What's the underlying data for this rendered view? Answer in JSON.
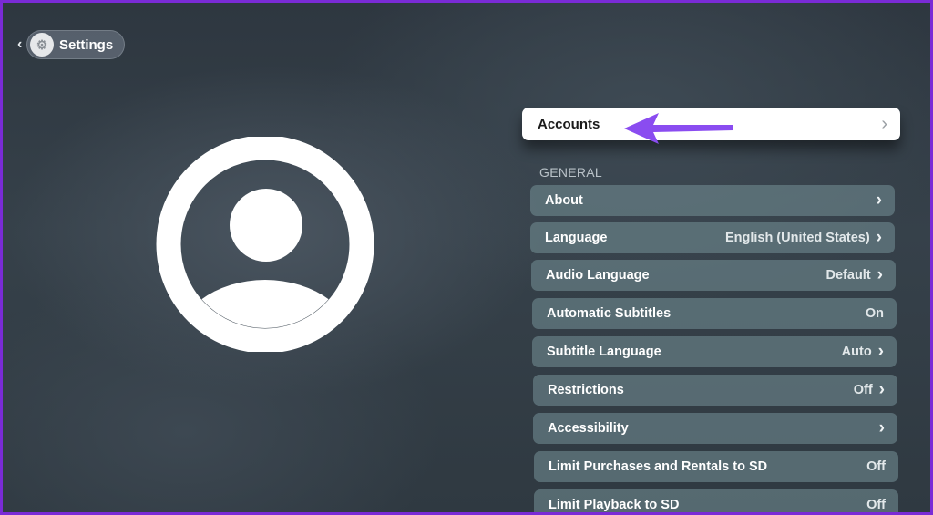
{
  "header": {
    "back_icon": "chevron-left-icon",
    "app_icon": "settings-gear-icon",
    "title": "Settings"
  },
  "profile": {
    "icon": "person-circle-icon"
  },
  "accounts": {
    "label": "Accounts",
    "chevron": "›",
    "annotation": "purple-arrow-pointing-left",
    "annotation_color": "#8a4cf0"
  },
  "general": {
    "header": "GENERAL",
    "items": [
      {
        "label": "About",
        "value": "",
        "chevron": "›"
      },
      {
        "label": "Language",
        "value": "English (United States)",
        "chevron": "›"
      },
      {
        "label": "Audio Language",
        "value": "Default",
        "chevron": "›"
      },
      {
        "label": "Automatic Subtitles",
        "value": "On",
        "chevron": ""
      },
      {
        "label": "Subtitle Language",
        "value": "Auto",
        "chevron": "›"
      },
      {
        "label": "Restrictions",
        "value": "Off",
        "chevron": "›"
      },
      {
        "label": "Accessibility",
        "value": "",
        "chevron": "›"
      },
      {
        "label": "Limit Purchases and Rentals to SD",
        "value": "Off",
        "chevron": ""
      },
      {
        "label": "Limit Playback to SD",
        "value": "Off",
        "chevron": ""
      }
    ]
  },
  "colors": {
    "frame": "#7a2bd6",
    "focused_row": "#ffffff",
    "row_bg": "#6e878e"
  }
}
